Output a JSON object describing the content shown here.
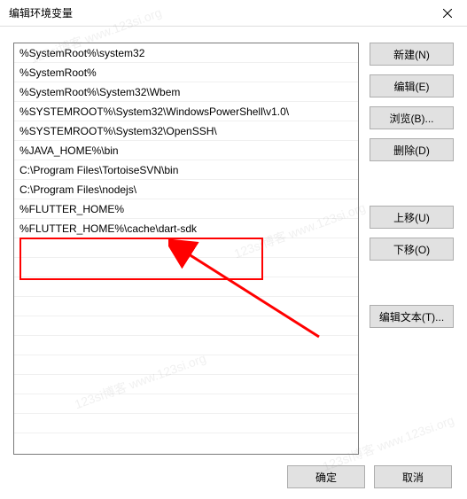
{
  "title": "编辑环境变量",
  "list": {
    "items": [
      "%SystemRoot%\\system32",
      "%SystemRoot%",
      "%SystemRoot%\\System32\\Wbem",
      "%SYSTEMROOT%\\System32\\WindowsPowerShell\\v1.0\\",
      "%SYSTEMROOT%\\System32\\OpenSSH\\",
      "%JAVA_HOME%\\bin",
      "C:\\Program Files\\TortoiseSVN\\bin",
      "C:\\Program Files\\nodejs\\",
      "%FLUTTER_HOME%",
      "%FLUTTER_HOME%\\cache\\dart-sdk"
    ]
  },
  "buttons": {
    "new": "新建(N)",
    "edit": "编辑(E)",
    "browse": "浏览(B)...",
    "delete": "删除(D)",
    "moveUp": "上移(U)",
    "moveDown": "下移(O)",
    "editText": "编辑文本(T)...",
    "ok": "确定",
    "cancel": "取消"
  },
  "watermark": "123si博客 www.123si.org"
}
